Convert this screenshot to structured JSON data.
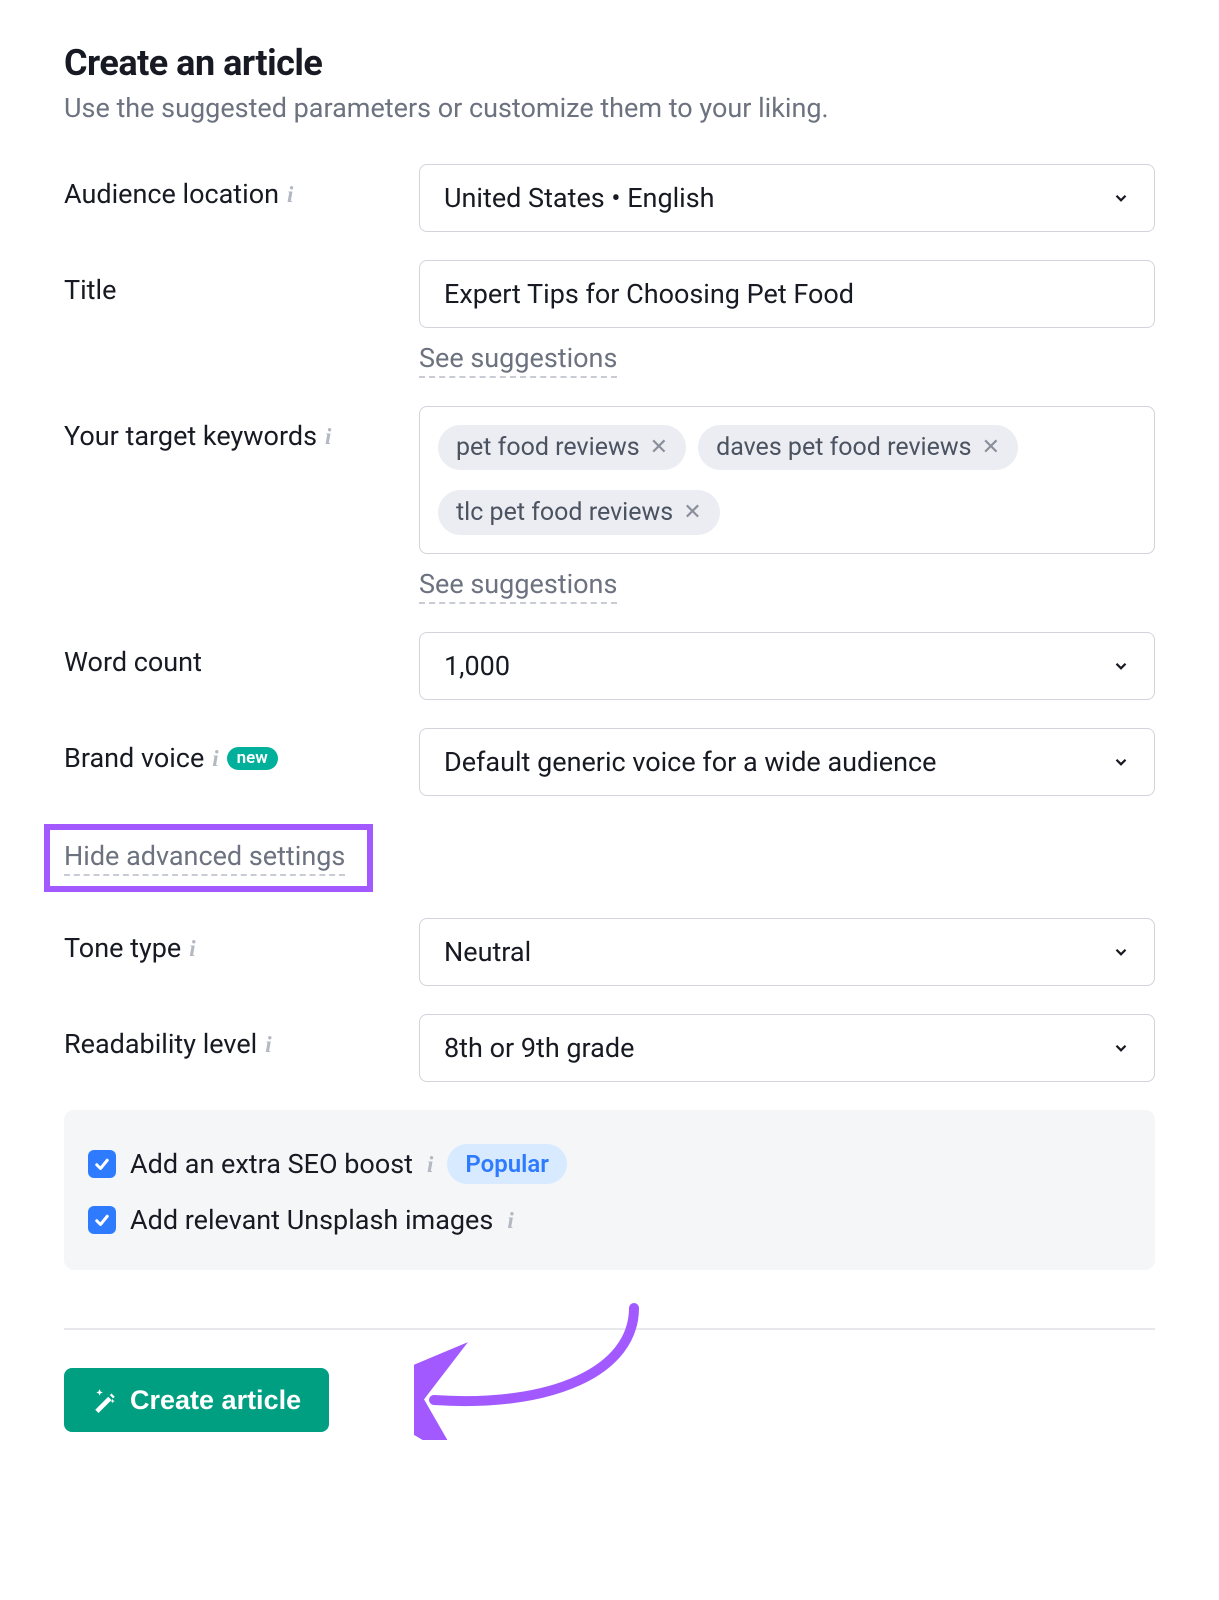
{
  "header": {
    "title": "Create an article",
    "subtitle": "Use the suggested parameters or customize them to your liking."
  },
  "fields": {
    "audience_location": {
      "label": "Audience location",
      "value": "United States • English"
    },
    "title": {
      "label": "Title",
      "value": "Expert Tips for Choosing Pet Food",
      "see_suggestions": "See suggestions"
    },
    "keywords": {
      "label": "Your target keywords",
      "pills": [
        "pet food reviews",
        "daves pet food reviews",
        "tlc pet food reviews"
      ],
      "see_suggestions": "See suggestions"
    },
    "word_count": {
      "label": "Word count",
      "value": "1,000"
    },
    "brand_voice": {
      "label": "Brand voice",
      "badge": "new",
      "value": "Default generic voice for a wide audience"
    },
    "advanced_toggle": "Hide advanced settings",
    "tone_type": {
      "label": "Tone type",
      "value": "Neutral"
    },
    "readability": {
      "label": "Readability level",
      "value": "8th or 9th grade"
    }
  },
  "options": {
    "seo_boost": {
      "label": "Add an extra SEO boost",
      "checked": true,
      "popular": "Popular"
    },
    "unsplash": {
      "label": "Add relevant Unsplash images",
      "checked": true
    }
  },
  "actions": {
    "create": "Create article"
  }
}
